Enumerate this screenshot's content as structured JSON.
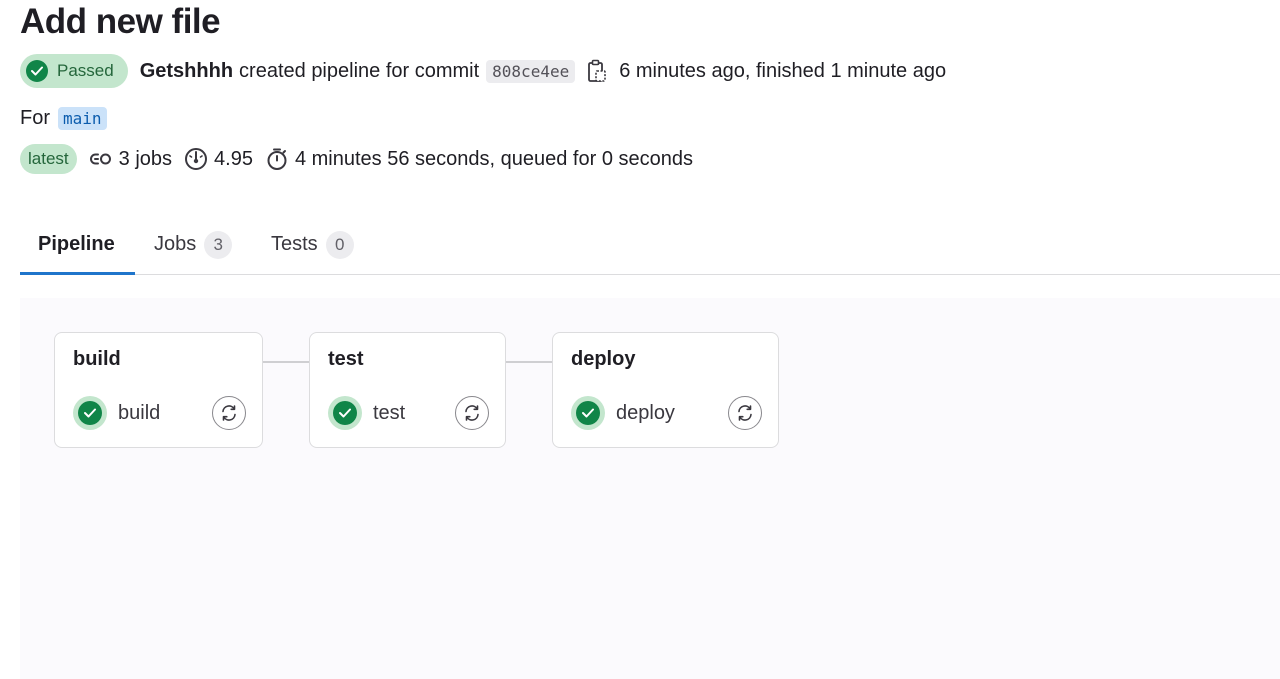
{
  "page": {
    "title": "Add new file"
  },
  "pipeline_header": {
    "status": "Passed",
    "author": "Getshhhh",
    "action_text": "created pipeline for commit",
    "commit_sha": "808ce4ee",
    "time_text": "6 minutes ago, finished 1 minute ago",
    "for_label": "For",
    "branch": "main",
    "latest_badge": "latest",
    "jobs_count_text": "3 jobs",
    "compute_text": "4.95",
    "duration_text": "4 minutes 56 seconds, queued for 0 seconds"
  },
  "tabs": [
    {
      "label": "Pipeline",
      "count": null,
      "active": true
    },
    {
      "label": "Jobs",
      "count": "3",
      "active": false
    },
    {
      "label": "Tests",
      "count": "0",
      "active": false
    }
  ],
  "stages": [
    {
      "name": "build",
      "jobs": [
        {
          "name": "build",
          "status": "success"
        }
      ]
    },
    {
      "name": "test",
      "jobs": [
        {
          "name": "test",
          "status": "success"
        }
      ]
    },
    {
      "name": "deploy",
      "jobs": [
        {
          "name": "deploy",
          "status": "success"
        }
      ]
    }
  ],
  "icons": {
    "status": "check-circle-icon",
    "copy": "copy-icon",
    "jobs": "pipeline-link-icon",
    "compute": "gauge-icon",
    "duration": "stopwatch-icon",
    "retry": "retry-icon"
  },
  "colors": {
    "success": "#108548",
    "success_bg": "#c3e6cd",
    "active_tab": "#1f75cb",
    "branch_bg": "#cbe2f9",
    "branch_text": "#0b5cad"
  }
}
